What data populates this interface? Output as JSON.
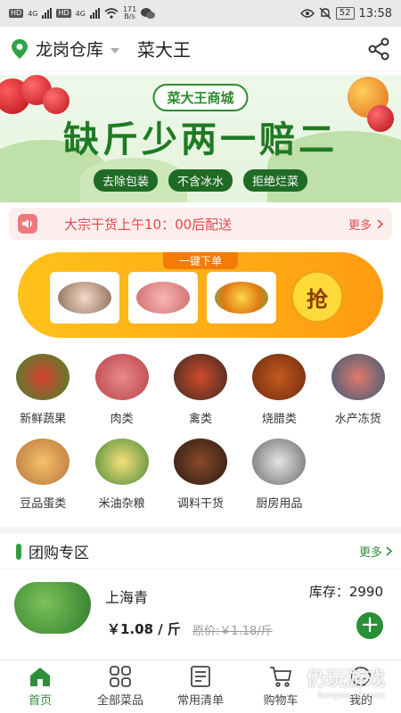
{
  "status_bar": {
    "hd1": "HD",
    "net1": "4G",
    "hd2": "HD",
    "net2": "4G",
    "speed_value": "171",
    "speed_unit": "B/s",
    "battery": "52",
    "time": "13:58"
  },
  "header": {
    "location": "龙岗仓库",
    "shop_name": "菜大王"
  },
  "banner": {
    "brand": "菜大王商城",
    "headline": "缺斤少两一赔二",
    "pills": [
      "去除包装",
      "不含冰水",
      "拒绝烂菜"
    ]
  },
  "notice": {
    "text": "大宗干货上午10：00后配送",
    "more": "更多"
  },
  "one_click": {
    "title": "一键下单",
    "grab_label": "抢"
  },
  "categories": [
    {
      "label": "新鲜蔬果"
    },
    {
      "label": "肉类"
    },
    {
      "label": "禽类"
    },
    {
      "label": "烧腊类"
    },
    {
      "label": "水产冻货"
    },
    {
      "label": "豆品蛋类"
    },
    {
      "label": "米油杂粮"
    },
    {
      "label": "调料干货"
    },
    {
      "label": "厨房用品"
    }
  ],
  "group_section": {
    "title": "团购专区",
    "more": "更多",
    "product": {
      "name": "上海青",
      "stock": "库存：2990",
      "price": "￥1.08 / 斤",
      "original_price": "原价:￥1.18/斤"
    }
  },
  "bottom_nav": {
    "items": [
      {
        "label": "首页",
        "icon": "home-icon",
        "active": true
      },
      {
        "label": "全部菜品",
        "icon": "grid-icon",
        "active": false
      },
      {
        "label": "常用清单",
        "icon": "list-icon",
        "active": false
      },
      {
        "label": "购物车",
        "icon": "cart-icon",
        "active": false
      },
      {
        "label": "我的",
        "icon": "user-icon",
        "active": false
      }
    ]
  },
  "watermark": {
    "text": "仍玩游戏",
    "sub": "Rengwan Games"
  },
  "colors": {
    "brand_green": "#2e8f3a",
    "notice_red": "#e24a4a",
    "orange": "#ff9b12"
  }
}
